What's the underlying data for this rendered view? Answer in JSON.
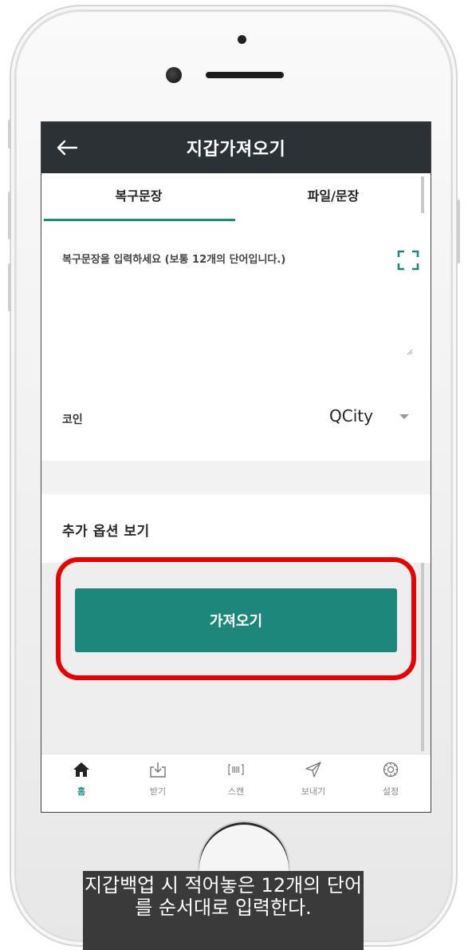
{
  "header": {
    "title": "지갑가져오기"
  },
  "tabs": [
    {
      "label": "복구문장"
    },
    {
      "label": "파일/문장"
    }
  ],
  "phrase": {
    "placeholder": "복구문장을 입력하세요 (보통 12개의 단어입니다.)"
  },
  "coin": {
    "label": "코인",
    "selected": "QCity"
  },
  "options": {
    "label": "추가 옵션 보기"
  },
  "import_button": {
    "label": "가져오기"
  },
  "nav": [
    {
      "label": "홈",
      "icon": "home-icon"
    },
    {
      "label": "받기",
      "icon": "receive-icon"
    },
    {
      "label": "스캔",
      "icon": "barcode-scan-icon"
    },
    {
      "label": "보내기",
      "icon": "send-icon"
    },
    {
      "label": "설정",
      "icon": "settings-icon"
    }
  ],
  "colors": {
    "accent": "#1d877b",
    "topbar": "#2b3134",
    "highlight": "#e60000"
  },
  "caption": {
    "text": "지갑백업 시 적어놓은 12개의 단어를 순서대로 입력한다."
  }
}
